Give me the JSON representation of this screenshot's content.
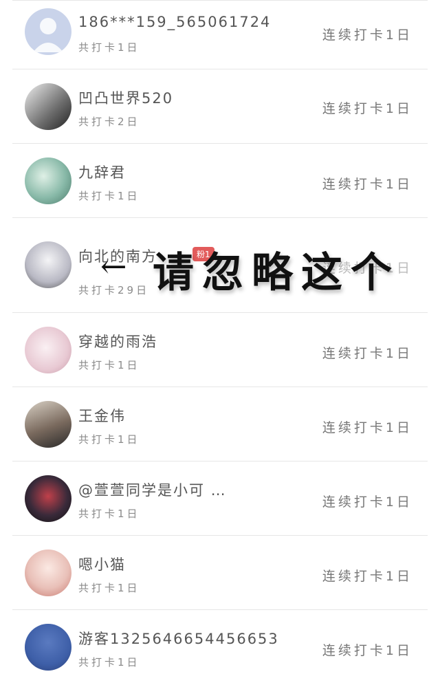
{
  "items": [
    {
      "name": "186***159_565061724",
      "total": "共打卡1日",
      "streak": "连续打卡1日",
      "avatar": "default-avatar",
      "avatar_color": "#c9d3ea"
    },
    {
      "name": "凹凸世界520",
      "total": "共打卡2日",
      "streak": "连续打卡1日",
      "avatar": "user-avatar",
      "avatar_color": "#8c8c8c"
    },
    {
      "name": "九辞君",
      "total": "共打卡1日",
      "streak": "连续打卡1日",
      "avatar": "user-avatar",
      "avatar_color": "#88b9a8"
    },
    {
      "name": "向北的南方",
      "total": "共打卡29日",
      "streak": "连续打卡1日",
      "avatar": "user-avatar",
      "avatar_color": "#b9b9c4",
      "badge": "粉1"
    },
    {
      "name": "穿越的雨浩",
      "total": "共打卡1日",
      "streak": "连续打卡1日",
      "avatar": "user-avatar",
      "avatar_color": "#e8c9d3"
    },
    {
      "name": "王金伟",
      "total": "共打卡1日",
      "streak": "连续打卡1日",
      "avatar": "user-avatar",
      "avatar_color": "#7a6a5e"
    },
    {
      "name": "@萱萱同学是小可 …",
      "total": "共打卡1日",
      "streak": "连续打卡1日",
      "avatar": "user-avatar",
      "avatar_color": "#3a2a3a"
    },
    {
      "name": "嗯小猫",
      "total": "共打卡1日",
      "streak": "连续打卡1日",
      "avatar": "user-avatar",
      "avatar_color": "#e9c0b8"
    },
    {
      "name": "游客1325646654456653",
      "total": "共打卡1日",
      "streak": "连续打卡1日",
      "avatar": "user-avatar",
      "avatar_color": "#3e5fa8"
    }
  ],
  "overlay": {
    "arrow": "←",
    "text": "请忽略这个"
  }
}
